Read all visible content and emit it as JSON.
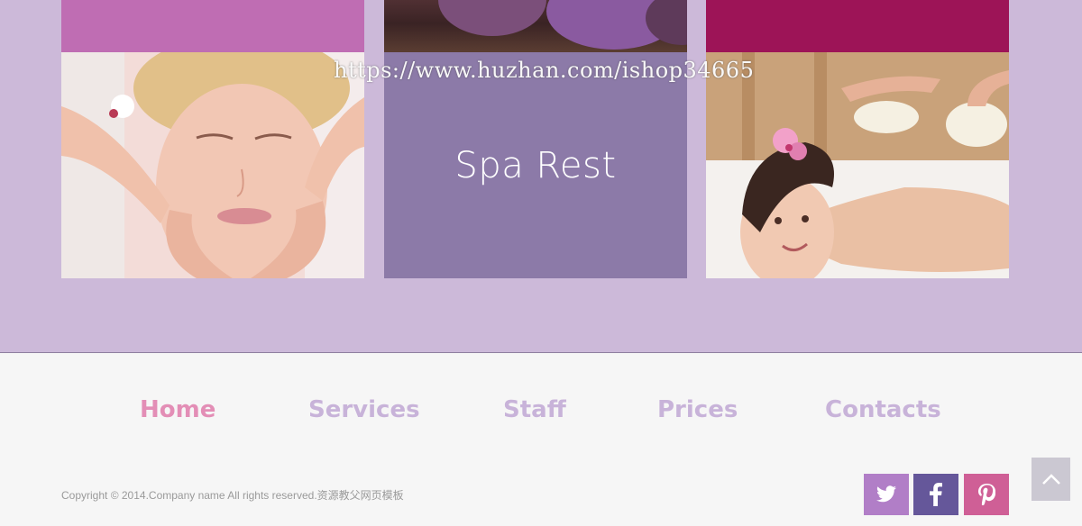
{
  "hero": {
    "center_title": "Spa Rest",
    "watermark": "https://www.huzhan.com/ishop34665"
  },
  "nav": {
    "items": [
      "Home",
      "Services",
      "Staff",
      "Prices",
      "Contacts"
    ],
    "active": "Home"
  },
  "footer": {
    "copyright": "Copyright © 2014.Company name All rights reserved.资源教父网页模板"
  },
  "social": {
    "icons": [
      "twitter-icon",
      "facebook-icon",
      "pinterest-icon"
    ]
  },
  "colors": {
    "page_bg": "#ccb9d9",
    "band_pink": "#bf6db3",
    "band_magenta": "#9d1457",
    "violet_block": "#8c7aa8",
    "nav_active": "#e38eb6",
    "nav_inactive": "#c8b3d9",
    "twitter_bg": "#b17ec7",
    "facebook_bg": "#65579a",
    "pinterest_bg": "#cf5f96"
  }
}
